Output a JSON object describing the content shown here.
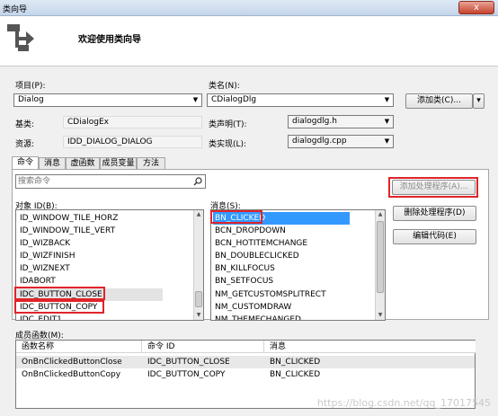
{
  "window": {
    "title": "类向导",
    "close": "x"
  },
  "header": {
    "welcome": "欢迎使用类向导"
  },
  "project": {
    "label": "项目(P):",
    "value": "Dialog"
  },
  "class_name": {
    "label": "类名(N):",
    "value": "CDialogDlg"
  },
  "add_class": {
    "label": "添加类(C)...",
    "arrow": "▾"
  },
  "base_class": {
    "label": "基类:",
    "value": "CDialogEx"
  },
  "class_decl": {
    "label": "类声明(T):",
    "value": "dialogdlg.h"
  },
  "resource": {
    "label": "资源:",
    "value": "IDD_DIALOG_DIALOG"
  },
  "class_impl": {
    "label": "类实现(L):",
    "value": "dialogdlg.cpp"
  },
  "tabs": [
    {
      "label": "命令",
      "active": true
    },
    {
      "label": "消息",
      "active": false
    },
    {
      "label": "虚函数",
      "active": false
    },
    {
      "label": "成员变量",
      "active": false
    },
    {
      "label": "方法",
      "active": false
    }
  ],
  "search": {
    "placeholder": "搜索命令"
  },
  "object_ids": {
    "label": "对象 ID(B):",
    "items": [
      {
        "text": "ID_WINDOW_TILE_HORZ",
        "state": "normal"
      },
      {
        "text": "ID_WINDOW_TILE_VERT",
        "state": "normal"
      },
      {
        "text": "ID_WIZBACK",
        "state": "normal"
      },
      {
        "text": "ID_WIZFINISH",
        "state": "normal"
      },
      {
        "text": "ID_WIZNEXT",
        "state": "normal"
      },
      {
        "text": "IDABORT",
        "state": "normal"
      },
      {
        "text": "IDC_BUTTON_CLOSE",
        "state": "highlighted"
      },
      {
        "text": "IDC_BUTTON_COPY",
        "state": "highlighted"
      },
      {
        "text": "IDC_EDIT1",
        "state": "normal"
      }
    ]
  },
  "messages": {
    "label": "消息(S):",
    "items": [
      {
        "text": "BN_CLICKED",
        "state": "selected"
      },
      {
        "text": "BCN_DROPDOWN",
        "state": "normal"
      },
      {
        "text": "BCN_HOTITEMCHANGE",
        "state": "normal"
      },
      {
        "text": "BN_DOUBLECLICKED",
        "state": "normal"
      },
      {
        "text": "BN_KILLFOCUS",
        "state": "normal"
      },
      {
        "text": "BN_SETFOCUS",
        "state": "normal"
      },
      {
        "text": "NM_GETCUSTOMSPLITRECT",
        "state": "normal"
      },
      {
        "text": "NM_CUSTOMDRAW",
        "state": "normal"
      },
      {
        "text": "NM_THEMECHANGED",
        "state": "normal"
      }
    ]
  },
  "buttons": {
    "add_handler": "添加处理程序(A)...",
    "delete_handler": "删除处理程序(D)",
    "edit_code": "编辑代码(E)"
  },
  "member_functions": {
    "label": "成员函数(M):",
    "columns": [
      "函数名称",
      "命令 ID",
      "消息"
    ],
    "rows": [
      [
        "OnBnClickedButtonClose",
        "IDC_BUTTON_CLOSE",
        "BN_CLICKED"
      ],
      [
        "OnBnClickedButtonCopy",
        "IDC_BUTTON_COPY",
        "BN_CLICKED"
      ]
    ]
  },
  "watermark": "https://blog.csdn.net/qq_17017545",
  "colors": {
    "selection": "#3399ff",
    "highlight_border": "#e0242a"
  }
}
